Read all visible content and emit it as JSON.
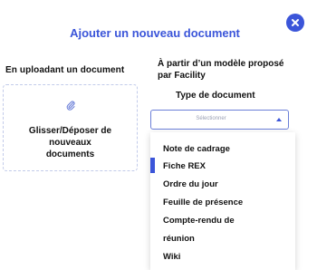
{
  "dialog": {
    "title": "Ajouter un nouveau document",
    "close_icon": "close-icon",
    "accent_color": "#3b55d9"
  },
  "upload": {
    "heading": "En uploadant un document",
    "dropzone_icon": "paperclip-icon",
    "dropzone_lines": [
      "Glisser/Déposer de",
      "nouveaux",
      "documents"
    ]
  },
  "model": {
    "heading_lines": [
      "À partir d’un modèle proposé",
      "par Facility"
    ],
    "doc_type_label": "Type de document",
    "select": {
      "value": "Sélectionner",
      "arrow_icon": "caret-up-icon"
    },
    "options": [
      "Note de cadrage",
      "Fiche REX",
      "Ordre du jour",
      "Feuille de présence",
      "Compte-rendu de",
      "réunion",
      "Wiki"
    ],
    "hovered_option": "Fiche REX"
  }
}
